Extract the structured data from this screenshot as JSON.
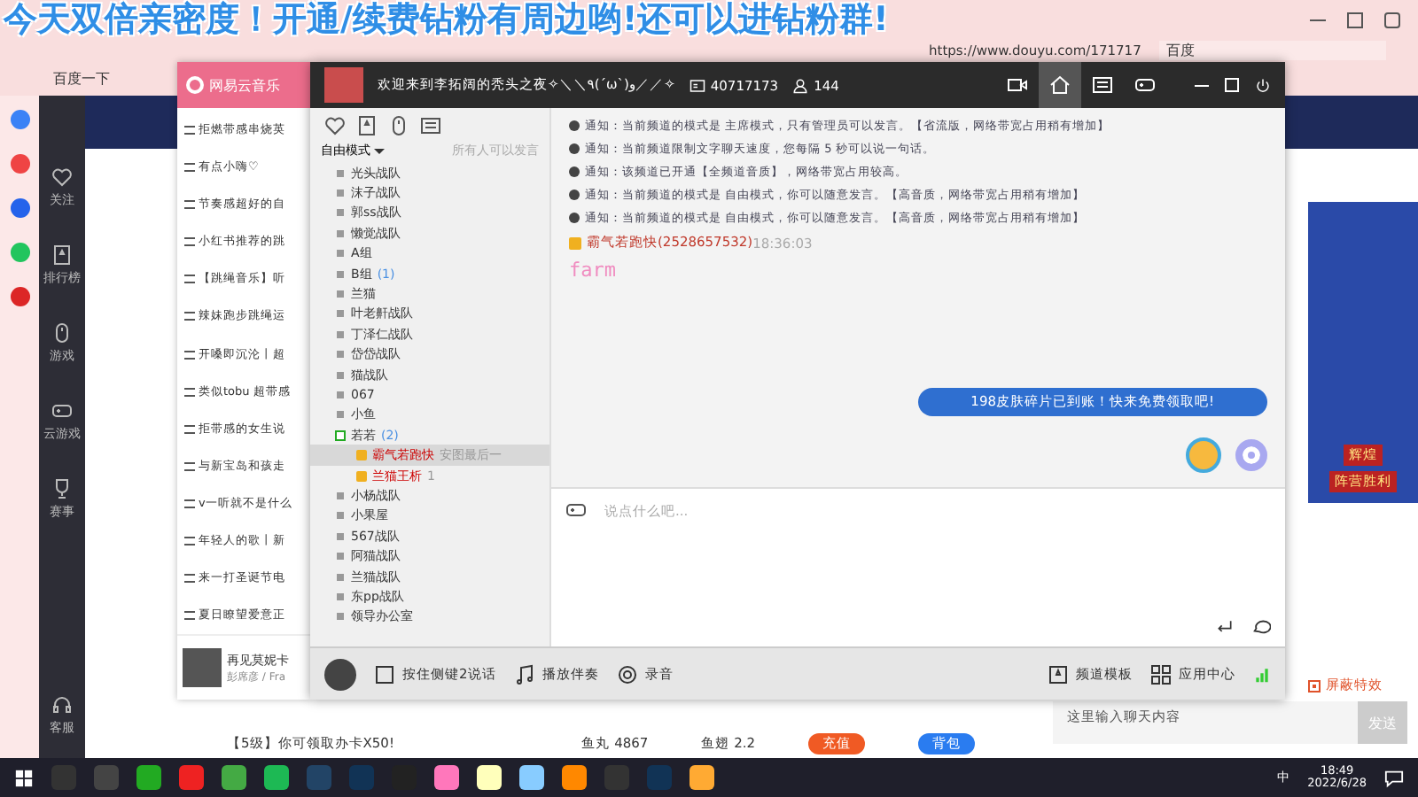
{
  "stream_overlay": {
    "text": "今天双倍亲密度！开通/续费钻粉有周边哟!还可以进钻粉群!"
  },
  "browser": {
    "url": "https://www.douyu.com/171717",
    "search_engine": "百度",
    "bookmark": "百度一下"
  },
  "site_sidebar": [
    {
      "label": "关注",
      "kind": "heart"
    },
    {
      "label": "排行榜",
      "kind": "rank"
    },
    {
      "label": "游戏",
      "kind": "mouse"
    },
    {
      "label": "云游戏",
      "kind": "game"
    },
    {
      "label": "赛事",
      "kind": "trophy"
    },
    {
      "label": "客服",
      "kind": "headset"
    }
  ],
  "music_player": {
    "title": "网易云音乐",
    "playlists": [
      "拒燃带感串烧英",
      "有点小嗨♡",
      "节奏感超好的自",
      "小红书推荐的跳",
      "【跳绳音乐】听",
      "辣妹跑步跳绳运",
      "开嗓即沉沦丨超",
      "类似tobu 超带感",
      "拒带感的女生说",
      "与新宝岛和孩走",
      "v一听就不是什么",
      "年轻人的歌丨新",
      "来一打圣诞节电",
      "夏日瞭望爱意正"
    ],
    "now_playing": {
      "song": "再见莫妮卡",
      "artist": "彭席彦 / Fra"
    }
  },
  "voice_chat": {
    "channel_title": "欢迎来到李拓阔的秃头之夜✧＼＼٩(ˊωˋ)و／／✧",
    "channel_id": "40717173",
    "online": "144",
    "header_nav": [
      {
        "kind": "video",
        "selected": false
      },
      {
        "kind": "home",
        "selected": true
      },
      {
        "kind": "list",
        "selected": false
      },
      {
        "kind": "game",
        "selected": false
      }
    ],
    "mode": "自由模式",
    "mode_note": "所有人可以发言",
    "channels": [
      {
        "name": "光头战队"
      },
      {
        "name": "沫子战队"
      },
      {
        "name": "郭ss战队"
      },
      {
        "name": "懒觉战队"
      },
      {
        "name": "A组"
      },
      {
        "name": "B组",
        "count": "(1)"
      },
      {
        "name": "兰猫"
      },
      {
        "name": "叶老鼾战队"
      },
      {
        "name": "丁泽仁战队"
      },
      {
        "name": "岱岱战队"
      },
      {
        "name": "猫战队"
      },
      {
        "name": "067"
      },
      {
        "name": "小鱼"
      },
      {
        "name": "若若",
        "count": "(2)",
        "expanded": true,
        "users": [
          {
            "name": "霸气若跑快",
            "status": "安图最后一",
            "selected": true
          },
          {
            "name": "兰猫王析",
            "status": "1",
            "selected": false
          }
        ]
      },
      {
        "name": "小杨战队"
      },
      {
        "name": "小果屋"
      },
      {
        "name": "567战队"
      },
      {
        "name": "阿猫战队"
      },
      {
        "name": "兰猫战队"
      },
      {
        "name": "东pp战队"
      },
      {
        "name": "领导办公室"
      }
    ],
    "messages": [
      {
        "kind": "notice",
        "text": "通知：当前频道的模式是 主席模式，只有管理员可以发言。【省流版，网络带宽占用稍有增加】"
      },
      {
        "kind": "notice",
        "text": "通知：当前频道限制文字聊天速度，您每隔 5 秒可以说一句话。"
      },
      {
        "kind": "notice",
        "text": "通知：该频道已开通【全频道音质】，网络带宽占用较高。"
      },
      {
        "kind": "notice",
        "text": "通知：当前频道的模式是 自由模式，你可以随意发言。【高音质，网络带宽占用稍有增加】"
      },
      {
        "kind": "notice",
        "text": "通知：当前频道的模式是 自由模式，你可以随意发言。【高音质，网络带宽占用稍有增加】"
      },
      {
        "kind": "user",
        "sender": "霸气若跑快(2528657532)",
        "time": "18:36:03",
        "text": "farm"
      }
    ],
    "promo": "198皮肤碎片已到账！快来免费领取吧!",
    "input": {
      "placeholder": "说点什么吧..."
    },
    "toolbar": [
      {
        "label": "按住侧键2说话",
        "kind": "talk"
      },
      {
        "label": "播放伴奏",
        "kind": "music"
      },
      {
        "label": "录音",
        "kind": "record"
      },
      {
        "label": "频道模板",
        "kind": "template"
      },
      {
        "label": "应用中心",
        "kind": "apps"
      }
    ]
  },
  "stream_page": {
    "notice": "【5级】你可领取办卡X50!",
    "fish_ball": "鱼丸 4867",
    "fish_fin": "鱼翅 2.2",
    "recharge": "充值",
    "bag": "背包",
    "block_effects": "屏蔽特效",
    "chat_placeholder": "这里输入聊天内容",
    "send": "发送",
    "side_banner": [
      "辉煌",
      "阵营胜利"
    ]
  },
  "taskbar": {
    "ime": "中",
    "time": "18:49",
    "date": "2022/6/28"
  }
}
